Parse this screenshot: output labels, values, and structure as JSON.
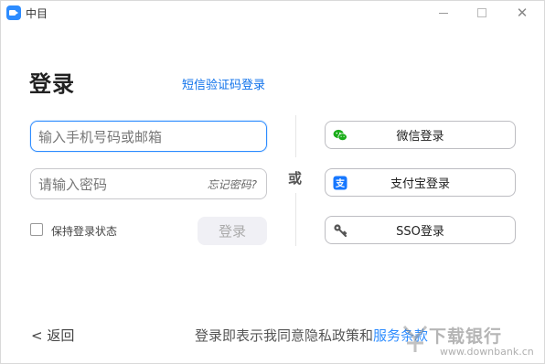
{
  "window": {
    "title": "中目"
  },
  "login": {
    "heading": "登录",
    "sms_link": "短信验证码登录",
    "phone_placeholder": "输入手机号码或邮箱",
    "password_placeholder": "请输入密码",
    "forgot_password": "忘记密码?",
    "keep_logged_in": "保持登录状态",
    "login_button": "登录"
  },
  "divider": {
    "or": "或"
  },
  "alt_login": [
    {
      "label": "微信登录",
      "icon": "wechat-icon",
      "color": "#1aad19"
    },
    {
      "label": "支付宝登录",
      "icon": "alipay-icon",
      "color": "#1677ff"
    },
    {
      "label": "SSO登录",
      "icon": "key-icon",
      "color": "#555555"
    }
  ],
  "footer": {
    "back": "< 返回",
    "legal_text": "登录即表示我同意隐私政策和服务条款",
    "legal_link": "服务条款"
  },
  "watermark": {
    "text": "下载银行",
    "url": "www.downbank.cn"
  },
  "colors": {
    "accent": "#2d8cff",
    "link": "#0e71eb"
  }
}
